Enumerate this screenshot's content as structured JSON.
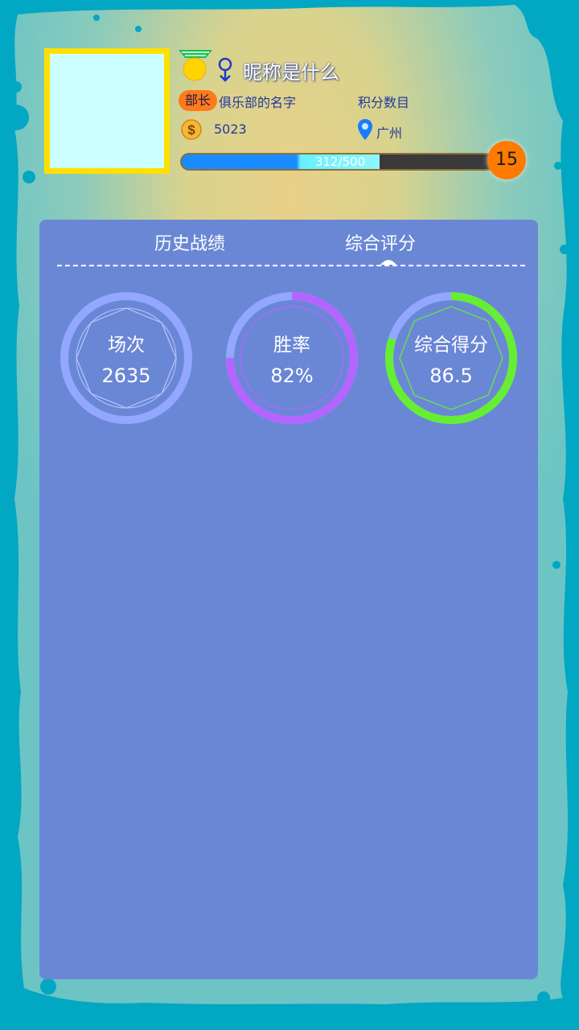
{
  "profile": {
    "nickname": "昵称是什么",
    "role": "部长",
    "club_name": "俱乐部的名字",
    "points_label": "积分数目",
    "coins": "5023",
    "location": "广州",
    "gender_icon": "female-symbol-icon",
    "medal_icon": "gold-medal-icon",
    "progress_text": "312/500",
    "progress_fraction": 0.624,
    "level": "15"
  },
  "tabs": {
    "history": "历史战绩",
    "overall": "综合评分",
    "active": "overall"
  },
  "stats": {
    "matches": {
      "label": "场次",
      "value": "2635",
      "ring_color": "#93a7ff"
    },
    "winrate": {
      "label": "胜率",
      "value": "82%",
      "ring_color": "#b565ff",
      "fraction": 0.75
    },
    "score": {
      "label": "综合得分",
      "value": "86.5",
      "ring_color": "#66ee33",
      "fraction": 0.8
    }
  },
  "colors": {
    "panel": "#6a87d6",
    "frame": "#02a7c3",
    "avatar_border": "#ffe000",
    "level_badge": "#ff7a00",
    "role_badge": "#ff7a1a"
  }
}
